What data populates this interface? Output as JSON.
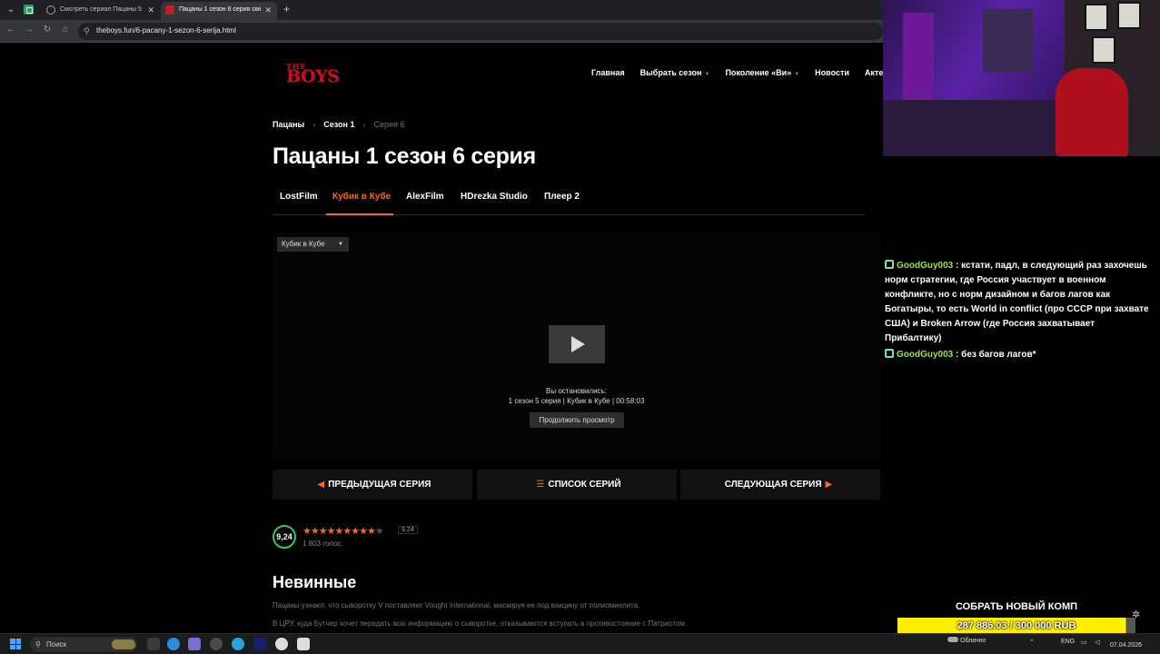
{
  "browser": {
    "tabs": [
      {
        "title": "Смотреть сериал Пацаны 5 се",
        "active": false
      },
      {
        "title": "Пацаны 1 сезон 6 серия смотр",
        "active": true
      }
    ],
    "url": "theboys.fun/6-pacany-1-sezon-6-serija.html"
  },
  "site": {
    "logo_top": "THE",
    "logo_main": "BOYS",
    "nav": [
      {
        "label": "Главная",
        "dropdown": false
      },
      {
        "label": "Выбрать сезон",
        "dropdown": true
      },
      {
        "label": "Поколение «Ви»",
        "dropdown": true
      },
      {
        "label": "Новости",
        "dropdown": false
      },
      {
        "label": "Актеры",
        "dropdown": false
      }
    ],
    "breadcrumb": [
      "Пацаны",
      "Сезон 1",
      "Серия 6"
    ],
    "title": "Пацаны 1 сезон 6 серия",
    "player_tabs": [
      "LostFilm",
      "Кубик в Кубе",
      "AlexFilm",
      "HDrezka Studio",
      "Плеер 2"
    ],
    "active_player_tab": "Кубик в Кубе",
    "player": {
      "voice_select": "Кубик в Кубе",
      "resume_label": "Вы остановились:",
      "resume_position": "1 сезон 5 серия | Кубик в Кубе | 00:58:03",
      "continue_button": "Продолжить просмотр"
    },
    "episode_nav": {
      "prev": "ПРЕДЫДУЩАЯ СЕРИЯ",
      "list": "СПИСОК СЕРИЙ",
      "next": "СЛЕДУЮЩАЯ СЕРИЯ"
    },
    "rating": {
      "value": "9,24",
      "score_badge": "9.24",
      "votes": "1 803 голос.",
      "stars_filled": 9,
      "stars_total": 10
    },
    "episode_title": "Невинные",
    "description": [
      "Пацаны узнают, что сыворотку V поставляет Vought International, маскируя ее под вакцину от полиомиелита.",
      "В ЦРУ, куда Бутчер хочет передать всю информацию о сыворотке, отказываются вступать в противостояние с Патриотом."
    ]
  },
  "overlay": {
    "chat": [
      {
        "user": "GoodGuy003",
        "text": ": кстати, падл, в следующий раз захочешь норм стратегии, где Россия участвует в военном конфликте, но с норм дизайном и багов лагов как Богатыры, то есть World in conflict (про СССР при захвате США) и Broken Arrow (где Россия захватывает Прибалтику)"
      },
      {
        "user": "GoodGuy003",
        "text": ": без багов лагов*"
      }
    ],
    "goal_title": "СОБРАТЬ НОВЫЙ КОМП",
    "goal_progress": "287 886.03 / 300 000 RUB",
    "goal_fraction": 0.96,
    "user_color": "#9de34b",
    "accent": "#f26a25"
  },
  "taskbar": {
    "search_placeholder": "Поиск",
    "weather": "Облачно",
    "language": "ENG",
    "date": "07.04.2026"
  }
}
